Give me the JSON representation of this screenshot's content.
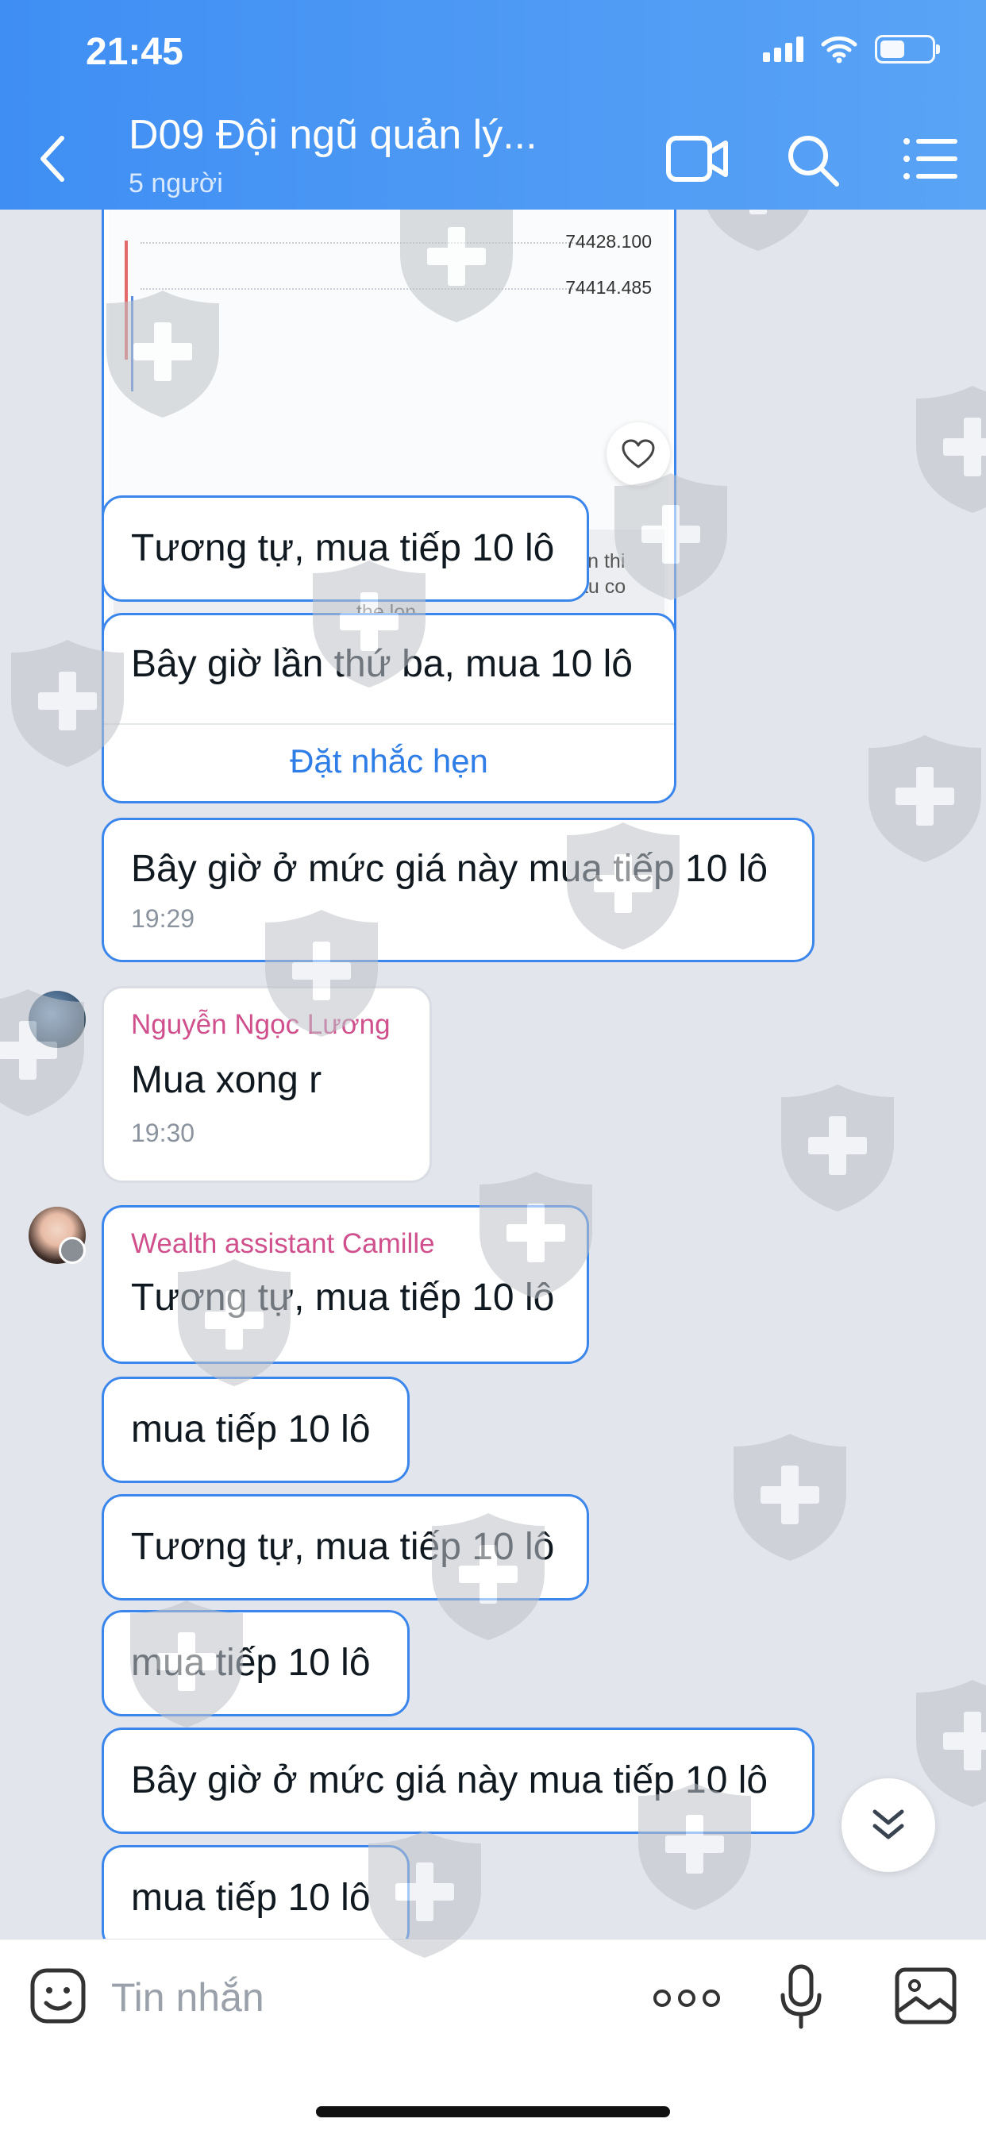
{
  "status_bar": {
    "time": "21:45"
  },
  "header": {
    "title": "D09 Đội ngũ quản lý...",
    "subtitle": "5 người",
    "accent_color": "#4a98f4",
    "icons": [
      "back-arrow-icon",
      "video-call-icon",
      "search-icon",
      "menu-list-icon"
    ]
  },
  "image_card": {
    "prices": [
      "74428.100",
      "74414.485"
    ],
    "notice": "Chu y! Giao dich se duoc thuc hien o cac dieu kien thi truong. Khac biet giua gia thi truong va gia yeu cau co the lon."
  },
  "messages": {
    "m1": {
      "text": "Tương tự, mua tiếp 10 lô"
    },
    "m2": {
      "text": "Bây giờ lần thứ ba, mua 10 lô",
      "action": "Đặt nhắc hẹn"
    },
    "m3": {
      "text": "Bây giờ ở mức giá này mua tiếp 10 lô",
      "time": "19:29"
    },
    "m4": {
      "sender": "Nguyễn Ngọc Lương",
      "text": "Mua xong r",
      "time": "19:30"
    },
    "m5": {
      "sender": "Wealth assistant Camille",
      "text": "Tương tự, mua tiếp 10 lô"
    },
    "m6": {
      "text": "mua tiếp 10 lô"
    },
    "m7": {
      "text": "Tương tự, mua tiếp 10 lô"
    },
    "m8": {
      "text": "mua tiếp 10 lô"
    },
    "m9": {
      "text": "Bây giờ ở mức giá này mua tiếp 10 lô"
    },
    "m10": {
      "text": "mua tiếp 10 lô"
    }
  },
  "composer": {
    "placeholder": "Tin nhắn"
  },
  "colors": {
    "bubble_border": "#3b86ec",
    "sender_name": "#d0508d",
    "link": "#2f7de6",
    "chat_bg": "#e2e6ec"
  }
}
